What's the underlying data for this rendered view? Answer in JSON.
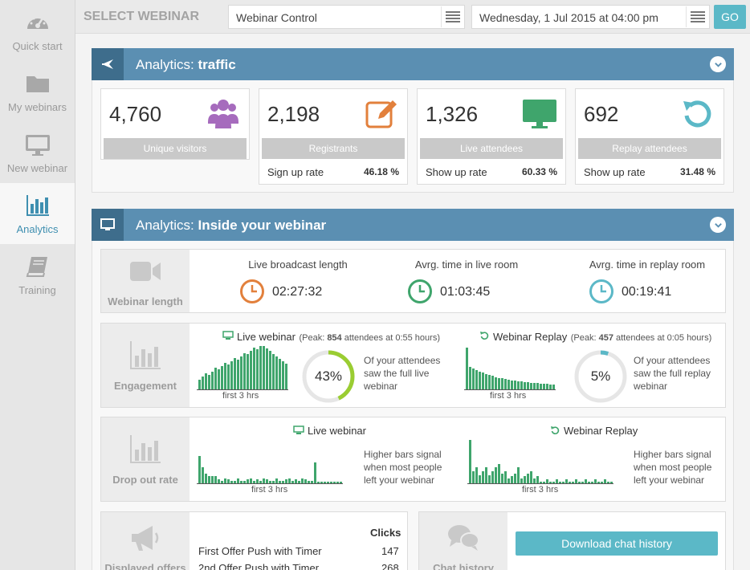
{
  "sidebar": {
    "items": [
      {
        "label": "Quick start",
        "icon": "speedometer-icon"
      },
      {
        "label": "My webinars",
        "icon": "folder-icon"
      },
      {
        "label": "New webinar",
        "icon": "monitor-icon"
      },
      {
        "label": "Analytics",
        "icon": "bar-chart-icon",
        "active": true
      },
      {
        "label": "Training",
        "icon": "book-icon"
      }
    ]
  },
  "topbar": {
    "title": "SELECT WEBINAR",
    "webinar_select": "Webinar Control",
    "date_select": "Wednesday, 1 Jul 2015 at 04:00 pm",
    "go": "GO"
  },
  "traffic": {
    "title_prefix": "Analytics: ",
    "title_bold": "traffic",
    "stats": [
      {
        "value": "4,760",
        "label": "Unique visitors",
        "icon": "users-icon",
        "color": "#a66bbd"
      },
      {
        "value": "2,198",
        "label": "Registrants",
        "icon": "edit-icon",
        "color": "#e2803c",
        "rate_label": "Sign up rate",
        "rate": "46.18 %"
      },
      {
        "value": "1,326",
        "label": "Live attendees",
        "icon": "monitor-icon",
        "color": "#3fa56c",
        "rate_label": "Show up rate",
        "rate": "60.33 %"
      },
      {
        "value": "692",
        "label": "Replay attendees",
        "icon": "replay-icon",
        "color": "#5bb8c7",
        "rate_label": "Show up rate",
        "rate": "31.48 %"
      }
    ]
  },
  "inside": {
    "title_prefix": "Analytics: ",
    "title_bold": "Inside your webinar",
    "length": {
      "side": "Webinar length",
      "items": [
        {
          "label": "Live broadcast length",
          "value": "02:27:32",
          "color": "#e2803c"
        },
        {
          "label": "Avrg. time in live room",
          "value": "01:03:45",
          "color": "#3fa56c"
        },
        {
          "label": "Avrg. time in replay room",
          "value": "00:19:41",
          "color": "#5bb8c7"
        }
      ]
    },
    "engagement": {
      "side": "Engagement",
      "live": {
        "title": "Live webinar",
        "peak_prefix": "(Peak: ",
        "peak_bold": "854",
        "peak_suffix": " attendees at 0:55 hours)",
        "axis": "first 3 hrs",
        "percent": "43%",
        "percent_value": 0.43,
        "desc": "Of your attendees saw the full live webinar",
        "color": "#9acd32"
      },
      "replay": {
        "title": "Webinar Replay",
        "peak_prefix": "(Peak: ",
        "peak_bold": "457",
        "peak_suffix": " attendees at 0:05 hours)",
        "axis": "first 3 hrs",
        "percent": "5%",
        "percent_value": 0.05,
        "desc": "Of your attendees saw the full replay webinar",
        "color": "#5bb8c7"
      }
    },
    "dropout": {
      "side": "Drop out rate",
      "live": {
        "title": "Live webinar",
        "axis": "first 3 hrs",
        "desc": "Higher bars signal when most people left your webinar"
      },
      "replay": {
        "title": "Webinar Replay",
        "axis": "first 3 hrs",
        "desc": "Higher bars signal when most people left your webinar"
      }
    },
    "offers": {
      "side": "Displayed offers",
      "col": "Clicks",
      "rows": [
        {
          "name": "First Offer Push with Timer",
          "clicks": "147"
        },
        {
          "name": "2nd Offer Push with Timer",
          "clicks": "268"
        }
      ]
    },
    "chat": {
      "side": "Chat history",
      "button": "Download chat history"
    }
  }
}
